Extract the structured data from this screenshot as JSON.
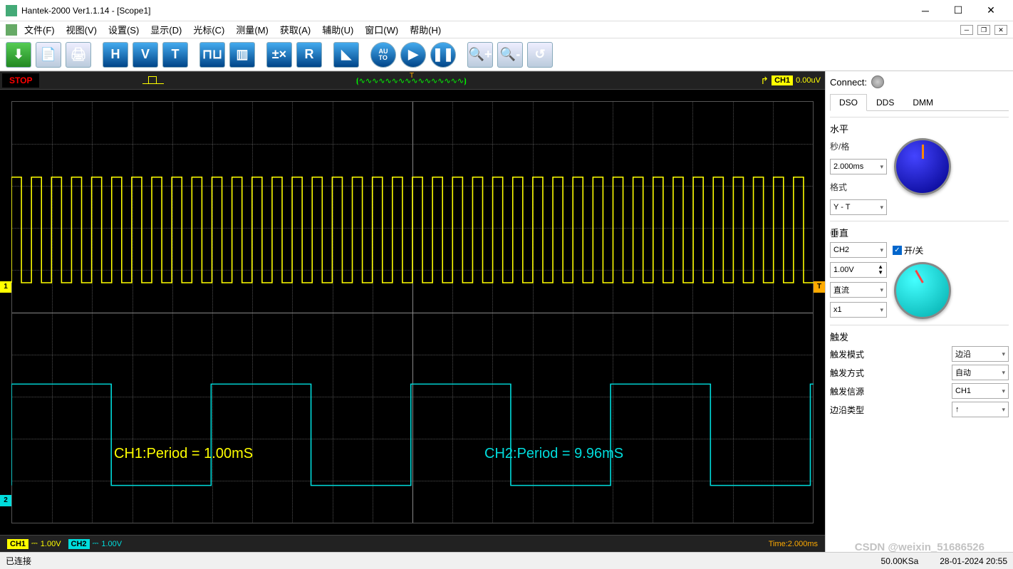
{
  "window": {
    "title": "Hantek-2000 Ver1.1.14 - [Scope1]"
  },
  "menu": {
    "items": [
      "文件(F)",
      "视图(V)",
      "设置(S)",
      "显示(D)",
      "光标(C)",
      "测量(M)",
      "获取(A)",
      "辅助(U)",
      "窗口(W)",
      "帮助(H)"
    ]
  },
  "toolbar": {
    "icons": [
      "download",
      "open",
      "print",
      "H",
      "V",
      "T",
      "pulse",
      "hist",
      "calc",
      "R",
      "db",
      "auto",
      "play",
      "pause",
      "zoom-in",
      "zoom-out",
      "reset"
    ]
  },
  "scope_top": {
    "status": "STOP",
    "trig_ch": "CH1",
    "trig_level": "0.00uV",
    "trig_mark": "T"
  },
  "measurements": {
    "ch1": "CH1:Period = 1.00mS",
    "ch2": "CH2:Period = 9.96mS"
  },
  "markers": {
    "ch1": "1",
    "ch2": "2",
    "t": "T"
  },
  "scope_bottom": {
    "ch1_label": "CH1",
    "ch1_coupling": "⎓",
    "ch1_scale": "1.00V",
    "ch2_label": "CH2",
    "ch2_coupling": "⎓",
    "ch2_scale": "1.00V",
    "time": "Time:2.000ms"
  },
  "panel": {
    "connect_label": "Connect:",
    "tabs": [
      "DSO",
      "DDS",
      "DMM"
    ],
    "horizontal": {
      "title": "水平",
      "sub": "秒/格",
      "time_div": "2.000ms",
      "format_label": "格式",
      "format": "Y - T"
    },
    "vertical": {
      "title": "垂直",
      "channel": "CH2",
      "onoff_label": "开/关",
      "volt_div": "1.00V",
      "coupling": "直流",
      "probe": "x1"
    },
    "trigger": {
      "title": "触发",
      "rows": [
        {
          "label": "触发模式",
          "value": "边沿"
        },
        {
          "label": "触发方式",
          "value": "自动"
        },
        {
          "label": "触发信源",
          "value": "CH1"
        },
        {
          "label": "边沿类型",
          "value": "↑"
        }
      ]
    }
  },
  "statusbar": {
    "left": "已连接",
    "sample": "50.00KSa",
    "datetime": "28-01-2024  20:55"
  },
  "watermark": "CSDN @weixin_51686526",
  "chart_data": {
    "type": "oscilloscope",
    "time_per_div_ms": 2.0,
    "divisions_x": 20,
    "series": [
      {
        "name": "CH1",
        "color": "#ffff00",
        "waveform": "square",
        "period_ms": 1.0,
        "amplitude_div": 2.5,
        "baseline_div": 4.3,
        "volts_per_div": 1.0,
        "measurement": "Period = 1.00mS"
      },
      {
        "name": "CH2",
        "color": "#00dddd",
        "waveform": "square",
        "period_ms": 9.96,
        "amplitude_div": 2.4,
        "baseline_div": 9.1,
        "volts_per_div": 1.0,
        "measurement": "Period = 9.96mS"
      }
    ]
  }
}
